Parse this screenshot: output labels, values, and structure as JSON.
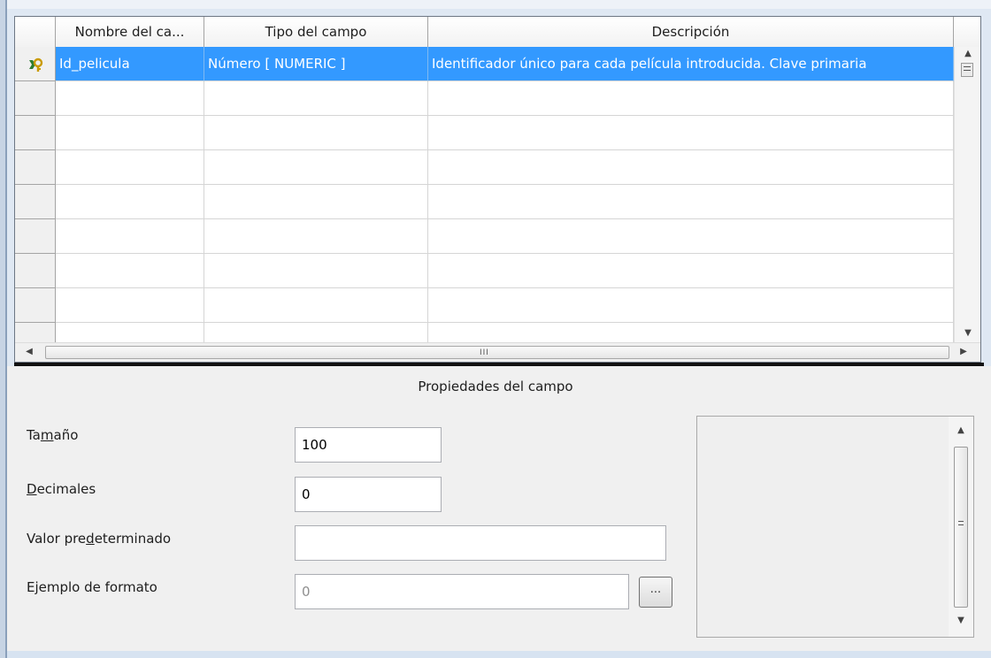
{
  "grid": {
    "columns": [
      "Nombre del ca...",
      "Tipo del campo",
      "Descripción"
    ],
    "rows": [
      {
        "name": "Id_pelicula",
        "type": "Número [ NUMERIC ]",
        "description": "Identificador único para cada película introducida. Clave primaria",
        "primary_key": true,
        "selected": true
      },
      {
        "name": "",
        "type": "",
        "description": ""
      },
      {
        "name": "",
        "type": "",
        "description": ""
      },
      {
        "name": "",
        "type": "",
        "description": ""
      },
      {
        "name": "",
        "type": "",
        "description": ""
      },
      {
        "name": "",
        "type": "",
        "description": ""
      },
      {
        "name": "",
        "type": "",
        "description": ""
      },
      {
        "name": "",
        "type": "",
        "description": ""
      },
      {
        "name": "",
        "type": "",
        "description": ""
      }
    ],
    "hscroll_grip": "III"
  },
  "properties": {
    "title": "Propiedades del campo",
    "tamano": {
      "label_pre": "Ta",
      "label_mn": "m",
      "label_post": "año",
      "value": "100"
    },
    "decimales": {
      "label_pre": "",
      "label_mn": "D",
      "label_post": "ecimales",
      "value": "0"
    },
    "valor_pred": {
      "label_pre": "Valor pre",
      "label_mn": "d",
      "label_post": "eterminado",
      "value": ""
    },
    "ejemplo": {
      "label": "Ejemplo de formato",
      "value": "0",
      "button_label": "..."
    }
  },
  "colors": {
    "selection": "#3399ff",
    "panel_bg": "#f0f0f0",
    "key_icon": "#e0b000"
  },
  "icons": {
    "row_marker": "primary-key-icon",
    "scroll_up": "chevron-up-icon",
    "scroll_down": "chevron-down-icon",
    "scroll_left": "chevron-left-icon",
    "scroll_right": "chevron-right-icon"
  }
}
